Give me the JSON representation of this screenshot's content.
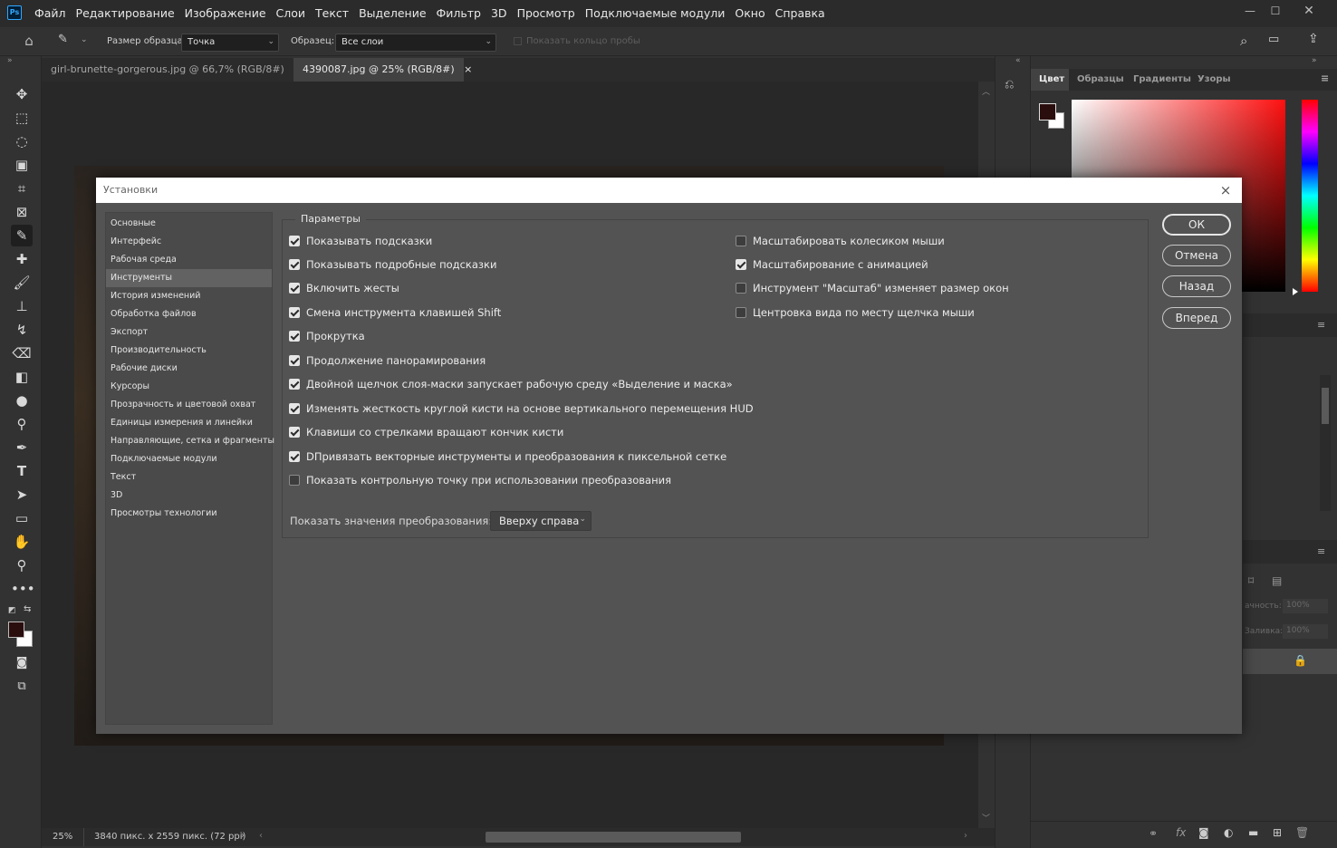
{
  "app": {
    "logo": "Ps"
  },
  "menu": [
    "Файл",
    "Редактирование",
    "Изображение",
    "Слои",
    "Текст",
    "Выделение",
    "Фильтр",
    "3D",
    "Просмотр",
    "Подключаемые модули",
    "Окно",
    "Справка"
  ],
  "options_bar": {
    "sample_size_label": "Размер образца:",
    "sample_size_value": "Точка",
    "sample_label": "Образец:",
    "sample_value": "Все слои",
    "show_ring_label": "Показать кольцо пробы"
  },
  "tabs": [
    {
      "label": "girl-brunette-gorgerous.jpg @ 66,7% (RGB/8#)",
      "close": "×"
    },
    {
      "label": "4390087.jpg @ 25% (RGB/8#)",
      "close": "×"
    }
  ],
  "status": {
    "zoom": "25%",
    "info": "3840 пикс. x 2559 пикс. (72 ppi)"
  },
  "right_panel": {
    "tabs": [
      "Цвет",
      "Образцы",
      "Градиенты",
      "Узоры"
    ],
    "opacity_label": "ачность:",
    "opacity_value": "100%",
    "fill_label": "Заливка:",
    "fill_value": "100%"
  },
  "dialog": {
    "title": "Установки",
    "close": "×",
    "categories": [
      "Основные",
      "Интерфейс",
      "Рабочая среда",
      "Инструменты",
      "История изменений",
      "Обработка файлов",
      "Экспорт",
      "Производительность",
      "Рабочие диски",
      "Курсоры",
      "Прозрачность и цветовой охват",
      "Единицы измерения и линейки",
      "Направляющие, сетка и фрагменты",
      "Подключаемые модули",
      "Текст",
      "3D",
      "Просмотры технологии"
    ],
    "selected_category": "Инструменты",
    "params_title": "Параметры",
    "left_options": [
      {
        "label": "Показывать подсказки",
        "checked": true
      },
      {
        "label": "Показывать подробные подсказки",
        "checked": true
      },
      {
        "label": "Включить жесты",
        "checked": true
      },
      {
        "label": "Смена инструмента клавишей Shift",
        "checked": true
      },
      {
        "label": "Прокрутка",
        "checked": true
      },
      {
        "label": "Продолжение панорамирования",
        "checked": true
      },
      {
        "label": "Двойной щелчок слоя-маски запускает рабочую среду «Выделение и маска»",
        "checked": true
      },
      {
        "label": "Изменять жесткость круглой кисти на основе вертикального перемещения HUD",
        "checked": true
      },
      {
        "label": "Клавиши со стрелками вращают кончик кисти",
        "checked": true
      },
      {
        "label": "DПривязать векторные инструменты и преобразования к пиксельной сетке",
        "checked": true
      },
      {
        "label": "Показать контрольную точку при использовании преобразования",
        "checked": false
      }
    ],
    "right_options": [
      {
        "label": "Масштабировать колесиком мыши",
        "checked": false
      },
      {
        "label": "Масштабирование с анимацией",
        "checked": true
      },
      {
        "label": "Инструмент \"Масштаб\" изменяет размер окон",
        "checked": false
      },
      {
        "label": "Центровка вида по месту щелчка мыши",
        "checked": false
      }
    ],
    "transform_label": "Показать значения преобразования:",
    "transform_value": "Вверху справа",
    "buttons": {
      "ok": "ОК",
      "cancel": "Отмена",
      "back": "Назад",
      "forward": "Вперед"
    }
  }
}
